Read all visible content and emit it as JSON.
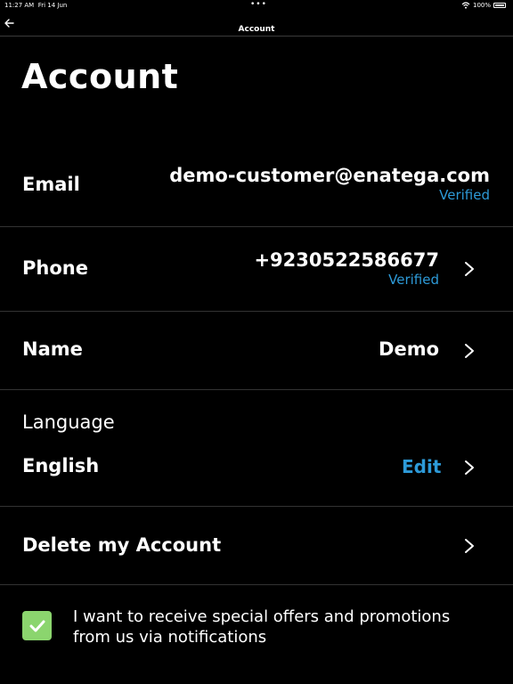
{
  "status": {
    "time": "11:27 AM",
    "date": "Fri 14 Jun",
    "battery": "100%"
  },
  "nav": {
    "title": "Account"
  },
  "header": {
    "title": "Account"
  },
  "rows": {
    "email": {
      "label": "Email",
      "value": "demo-customer@enatega.com",
      "status": "Verified"
    },
    "phone": {
      "label": "Phone",
      "value": "+9230522586677",
      "status": "Verified"
    },
    "name": {
      "label": "Name",
      "value": "Demo"
    },
    "language": {
      "label": "Language",
      "value": "English",
      "action": "Edit"
    },
    "delete": {
      "label": "Delete my Account"
    }
  },
  "consent": {
    "checked": true,
    "text": "I want to receive special offers and promotions from us via notifications"
  },
  "colors": {
    "accent": "#2d9ad8",
    "checkbox": "#8bd56e",
    "background": "#000000"
  }
}
